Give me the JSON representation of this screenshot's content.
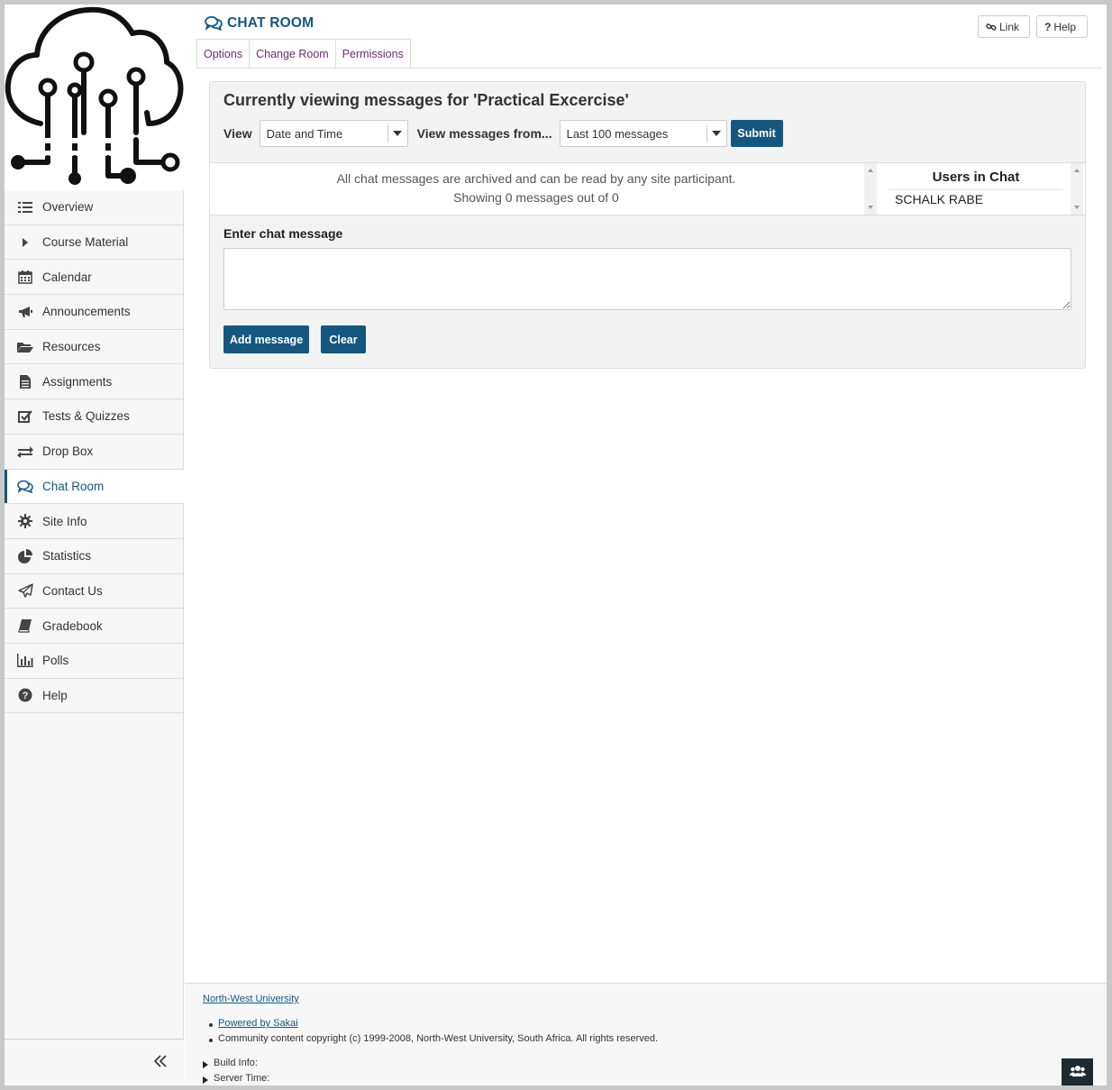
{
  "sidebar": {
    "logo": "circuit-cloud-logo",
    "items": [
      {
        "label": "Overview",
        "icon": "list-icon"
      },
      {
        "label": "Course Material",
        "icon": "caret-right-icon"
      },
      {
        "label": "Calendar",
        "icon": "calendar-icon"
      },
      {
        "label": "Announcements",
        "icon": "bullhorn-icon"
      },
      {
        "label": "Resources",
        "icon": "folder-open-icon"
      },
      {
        "label": "Assignments",
        "icon": "file-text-icon"
      },
      {
        "label": "Tests & Quizzes",
        "icon": "check-square-icon"
      },
      {
        "label": "Drop Box",
        "icon": "exchange-icon"
      },
      {
        "label": "Chat Room",
        "icon": "comments-icon",
        "active": true
      },
      {
        "label": "Site Info",
        "icon": "gear-icon"
      },
      {
        "label": "Statistics",
        "icon": "pie-chart-icon"
      },
      {
        "label": "Contact Us",
        "icon": "paper-plane-icon"
      },
      {
        "label": "Gradebook",
        "icon": "book-icon"
      },
      {
        "label": "Polls",
        "icon": "bar-chart-icon"
      },
      {
        "label": "Help",
        "icon": "question-circle-icon"
      }
    ],
    "collapse_icon": "double-chevron-left-icon"
  },
  "header": {
    "title": "CHAT ROOM",
    "link_label": "Link",
    "help_label": "Help"
  },
  "tabs": [
    {
      "label": "Options"
    },
    {
      "label": "Change Room"
    },
    {
      "label": "Permissions"
    }
  ],
  "panel": {
    "heading": "Currently viewing messages for 'Practical Excercise'",
    "view_label": "View",
    "view_select": "Date and Time",
    "from_label": "View messages from...",
    "from_select": "Last 100 messages",
    "submit_label": "Submit",
    "archive_note": "All chat messages are archived and can be read by any site participant.",
    "showing_note": "Showing 0 messages out of 0",
    "users_heading": "Users in Chat",
    "users": [
      "SCHALK RABE"
    ],
    "enter_label": "Enter chat message",
    "message_value": "",
    "add_label": "Add message",
    "clear_label": "Clear"
  },
  "footer": {
    "institution": "North-West University",
    "powered_by": "Powered by Sakai",
    "copyright": "Community content copyright (c) 1999-2008, North-West University, South Africa. All rights reserved.",
    "build_info": "Build Info:",
    "server_time": "Server Time:"
  },
  "colors": {
    "accent": "#15577e",
    "tab_text": "#6f2c73",
    "presence_bg": "#1f2a30"
  }
}
